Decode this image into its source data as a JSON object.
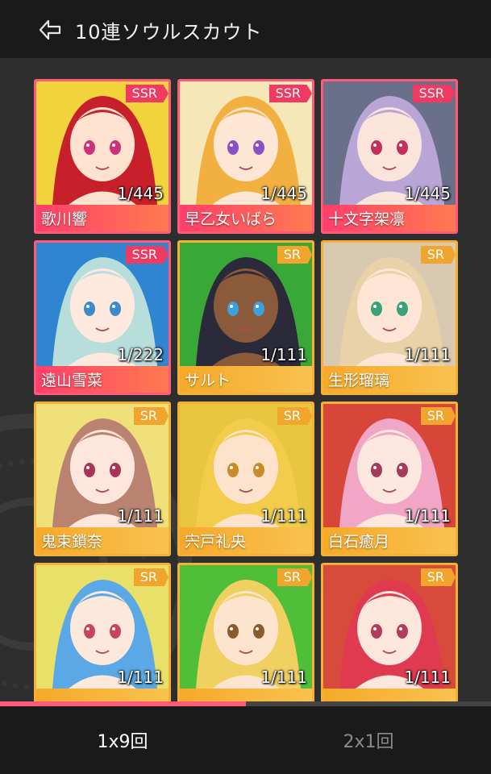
{
  "header": {
    "title": "10連ソウルスカウト",
    "back_icon": "back-arrow-icon"
  },
  "cards": [
    {
      "name": "歌川響",
      "rarity": "SSR",
      "count": "1/445",
      "bg": "#f2d33b",
      "hair": "#c8202a",
      "skin": "#fde3cf",
      "eye": "#d0307a"
    },
    {
      "name": "早乙女いばら",
      "rarity": "SSR",
      "count": "1/445",
      "bg": "#f6e7b8",
      "hair": "#f2b040",
      "skin": "#fde6d4",
      "eye": "#8a4fc9"
    },
    {
      "name": "十文字架凛",
      "rarity": "SSR",
      "count": "1/445",
      "bg": "#6a6f8a",
      "hair": "#b9a6d6",
      "skin": "#fbe5da",
      "eye": "#c2305a"
    },
    {
      "name": "遠山雪菜",
      "rarity": "SSR",
      "count": "1/222",
      "bg": "#2f85d0",
      "hair": "#b8dedc",
      "skin": "#fde9de",
      "eye": "#3d8bc9"
    },
    {
      "name": "サルト",
      "rarity": "SR",
      "count": "1/111",
      "bg": "#3aa836",
      "hair": "#2a2a3a",
      "skin": "#8a5a3a",
      "eye": "#3aa0e0"
    },
    {
      "name": "生形瑠璃",
      "rarity": "SR",
      "count": "1/111",
      "bg": "#d9c9b0",
      "hair": "#e9d2a8",
      "skin": "#fde6d6",
      "eye": "#3ca27a"
    },
    {
      "name": "鬼束鎖奈",
      "rarity": "SR",
      "count": "1/111",
      "bg": "#efe07a",
      "hair": "#b98370",
      "skin": "#fde7dc",
      "eye": "#a8345a"
    },
    {
      "name": "宍戸礼央",
      "rarity": "SR",
      "count": "1/111",
      "bg": "#e8c640",
      "hair": "#f2cc4a",
      "skin": "#fde3cc",
      "eye": "#c98a2a"
    },
    {
      "name": "白石癒月",
      "rarity": "SR",
      "count": "1/111",
      "bg": "#d8463a",
      "hair": "#f1a6c6",
      "skin": "#fde8e0",
      "eye": "#a63a5a"
    },
    {
      "name": "",
      "rarity": "SR",
      "count": "1/111",
      "bg": "#e9e06a",
      "hair": "#5aa9e6",
      "skin": "#fde8dc",
      "eye": "#c8445a"
    },
    {
      "name": "",
      "rarity": "SR",
      "count": "1/111",
      "bg": "#4fbf3a",
      "hair": "#f0d060",
      "skin": "#fde4cf",
      "eye": "#8a5a2a"
    },
    {
      "name": "",
      "rarity": "SR",
      "count": "1/111",
      "bg": "#d84a3a",
      "hair": "#e03a50",
      "skin": "#fde6dc",
      "eye": "#b23a5a"
    }
  ],
  "progress": {
    "fraction": 0.5
  },
  "footer": {
    "tab_active": "1x9回",
    "tab_inactive": "2x1回"
  },
  "colors": {
    "ssr": "#ff5a7a",
    "sr": "#f4b13a",
    "accent": "#ff5a7a"
  }
}
